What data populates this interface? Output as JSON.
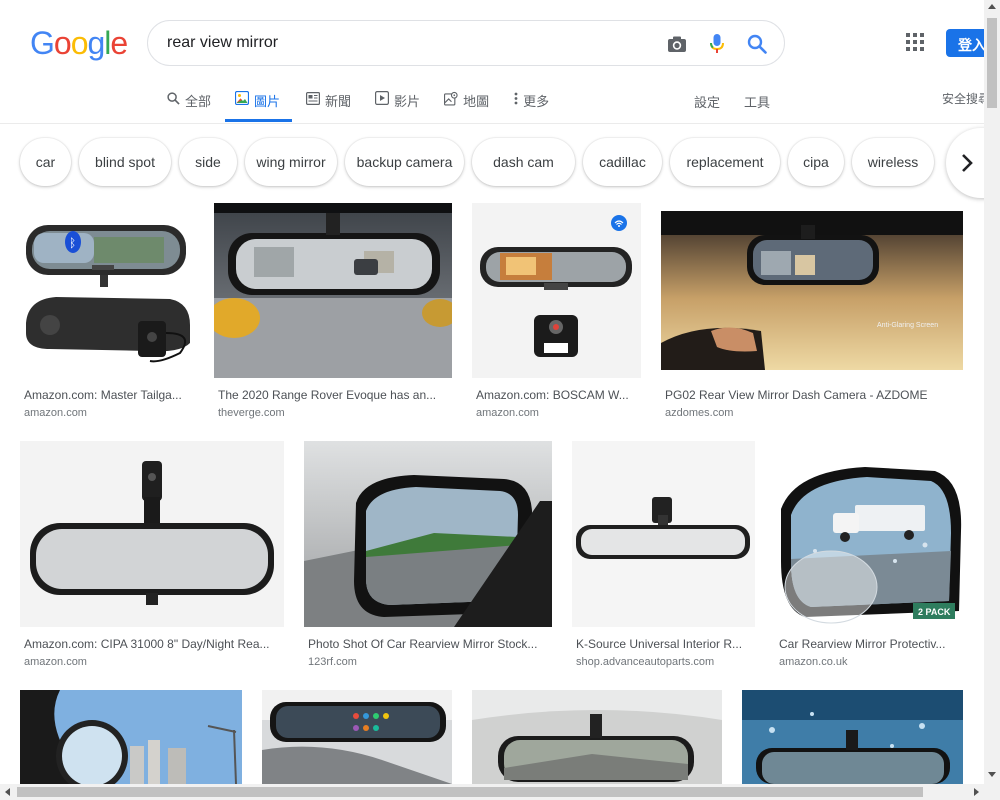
{
  "logo": {
    "letters": [
      "G",
      "o",
      "o",
      "g",
      "l",
      "e"
    ],
    "colors": [
      "#4285f4",
      "#ea4335",
      "#fbbc05",
      "#4285f4",
      "#34a853",
      "#ea4335"
    ]
  },
  "search": {
    "query": "rear view mirror"
  },
  "header": {
    "signin_label": "登入",
    "safe_search_label": "安全搜尋",
    "settings_label": "設定",
    "tools_label": "工具"
  },
  "tabs": [
    {
      "label": "全部",
      "icon": "search-icon",
      "active": false
    },
    {
      "label": "圖片",
      "icon": "image-icon",
      "active": true
    },
    {
      "label": "新聞",
      "icon": "news-icon",
      "active": false
    },
    {
      "label": "影片",
      "icon": "video-icon",
      "active": false
    },
    {
      "label": "地圖",
      "icon": "map-icon",
      "active": false
    },
    {
      "label": "更多",
      "icon": "more-vert-icon",
      "active": false
    }
  ],
  "chips": [
    "car",
    "blind spot",
    "side",
    "wing mirror",
    "backup camera",
    "dash cam",
    "cadillac",
    "replacement",
    "cipa",
    "wireless"
  ],
  "results": [
    {
      "title": "Amazon.com: Master Tailga...",
      "domain": "amazon.com"
    },
    {
      "title": "The 2020 Range Rover Evoque has an...",
      "domain": "theverge.com"
    },
    {
      "title": "Amazon.com: BOSCAM W...",
      "domain": "amazon.com"
    },
    {
      "title": "PG02 Rear View Mirror Dash Camera - AZDOME",
      "domain": "azdomes.com"
    },
    {
      "title": "Amazon.com: CIPA 31000 8\" Day/Night Rea...",
      "domain": "amazon.com"
    },
    {
      "title": "Photo Shot Of Car Rearview Mirror Stock...",
      "domain": "123rf.com"
    },
    {
      "title": "K-Source Universal Interior R...",
      "domain": "shop.advanceautoparts.com"
    },
    {
      "title": "Car Rearview Mirror Protectiv...",
      "domain": "amazon.co.uk"
    }
  ],
  "image_texts": {
    "anti_glare": "Anti-Glaring Screen",
    "two_pack": "2 PACK"
  },
  "colors": {
    "accent": "#1a73e8",
    "mic_blue": "#4285f4",
    "mic_red": "#ea4335",
    "mic_yellow": "#fbbc05",
    "mic_green": "#34a853"
  }
}
